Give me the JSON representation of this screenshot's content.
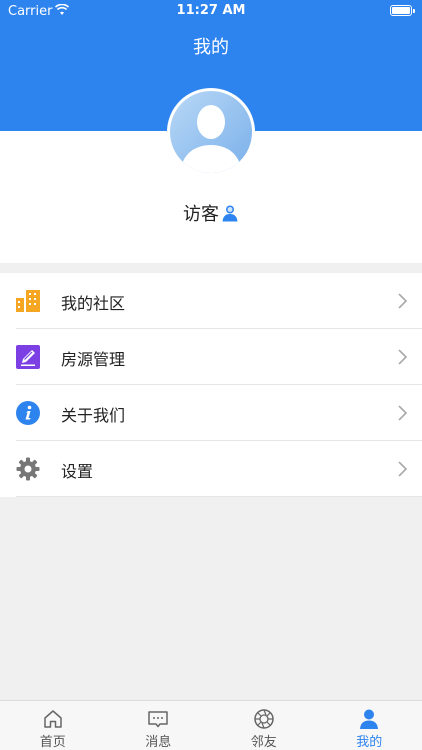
{
  "status_bar": {
    "carrier": "Carrier",
    "time": "11:27 AM"
  },
  "nav": {
    "title": "我的"
  },
  "profile": {
    "username": "访客"
  },
  "menu": {
    "items": [
      {
        "label": "我的社区",
        "icon": "community-building-icon"
      },
      {
        "label": "房源管理",
        "icon": "edit-pen-icon"
      },
      {
        "label": "关于我们",
        "icon": "info-icon"
      },
      {
        "label": "设置",
        "icon": "gear-icon"
      }
    ]
  },
  "tabbar": {
    "tabs": [
      {
        "label": "首页",
        "icon": "home-icon"
      },
      {
        "label": "消息",
        "icon": "message-icon"
      },
      {
        "label": "邻友",
        "icon": "neighbor-aperture-icon"
      },
      {
        "label": "我的",
        "icon": "user-icon"
      }
    ],
    "active": "我的"
  },
  "colors": {
    "primary": "#2e84ef",
    "background": "#f0f0f0",
    "community_icon": "#f5a623",
    "edit_icon": "#7b3fe4",
    "info_icon": "#2e84ef",
    "gear_icon": "#777777"
  }
}
